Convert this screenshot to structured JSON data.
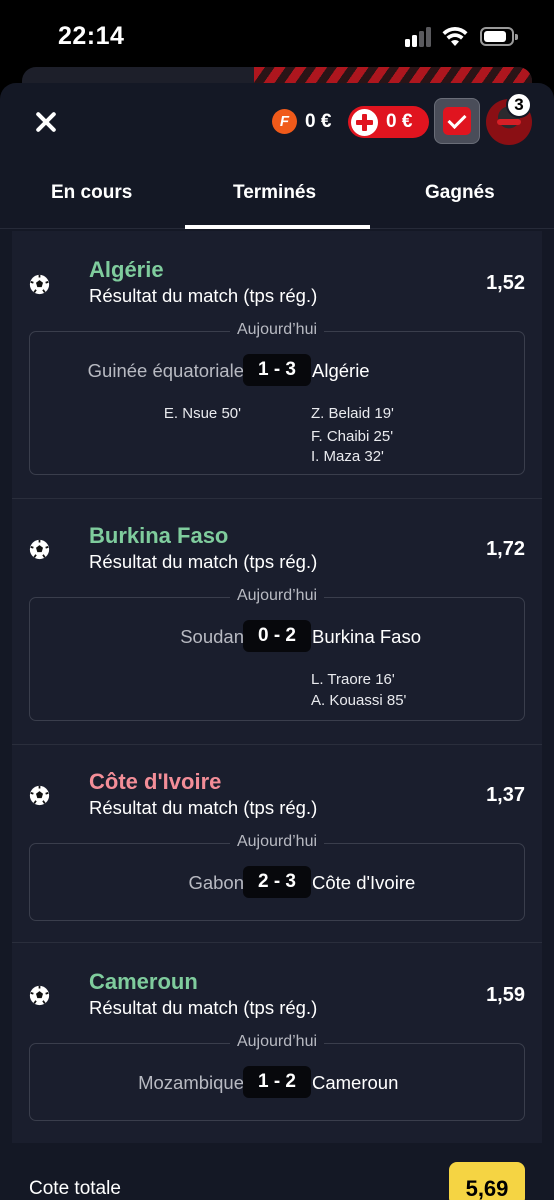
{
  "status_bar": {
    "time": "22:14"
  },
  "header": {
    "freebet_icon_letter": "F",
    "freebet_amount": "0 €",
    "bonus_amount": "0 €",
    "badge_count": "3"
  },
  "tabs": [
    {
      "label": "En cours"
    },
    {
      "label": "Terminés",
      "active": true
    },
    {
      "label": "Gagnés"
    }
  ],
  "bets": [
    {
      "pick": "Algérie",
      "pick_color": "green",
      "market": "Résultat du match (tps rég.)",
      "odds": "1,52",
      "date": "Aujourd’hui",
      "home": "Guinée équatoriale",
      "score": "1 - 3",
      "away": "Algérie",
      "home_scorers": [
        "E. Nsue 50'"
      ],
      "away_scorers": [
        "Z. Belaid 19'",
        "F. Chaibi 25'",
        "I. Maza 32'"
      ]
    },
    {
      "pick": "Burkina Faso",
      "pick_color": "green",
      "market": "Résultat du match (tps rég.)",
      "odds": "1,72",
      "date": "Aujourd’hui",
      "home": "Soudan",
      "score": "0 - 2",
      "away": "Burkina Faso",
      "home_scorers": [],
      "away_scorers": [
        "L. Traore 16'",
        "A. Kouassi  85'"
      ]
    },
    {
      "pick": "Côte d'Ivoire",
      "pick_color": "pink",
      "market": "Résultat du match (tps rég.)",
      "odds": "1,37",
      "date": "Aujourd’hui",
      "home": "Gabon",
      "score": "2 - 3",
      "away": "Côte d'Ivoire",
      "home_scorers": [],
      "away_scorers": []
    },
    {
      "pick": "Cameroun",
      "pick_color": "green",
      "market": "Résultat du match (tps rég.)",
      "odds": "1,59",
      "date": "Aujourd’hui",
      "home": "Mozambique",
      "score": "1 - 2",
      "away": "Cameroun",
      "home_scorers": [],
      "away_scorers": []
    }
  ],
  "footer": {
    "label": "Cote totale",
    "total_odds": "5,69"
  },
  "colors": {
    "accent_red": "#e0141f",
    "win_green": "#7fcc9d",
    "loss_pink": "#f38e98",
    "total_yellow": "#f5d443"
  },
  "icons": [
    "close-icon",
    "freebet-icon",
    "bonus-plus-icon",
    "checkmark-icon",
    "avatar",
    "football-icon"
  ]
}
